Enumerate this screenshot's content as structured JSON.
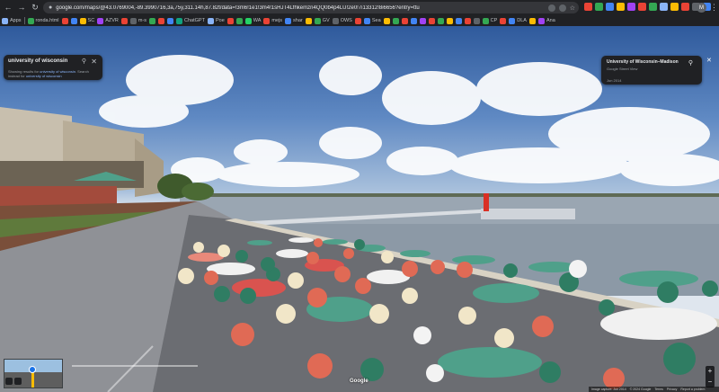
{
  "browser": {
    "url": "google.com/maps/@43.0769004,-89.3990716,3a,75y,311.14h,87.82t/data=!3m6!1e1!3m4!1sHJT4Lfhkemzn4QQ0b4p4LU!2e0!7i13312!8i6656?entry=ttu",
    "profile_initial": "M"
  },
  "bookmarks": [
    {
      "label": "Apps",
      "color": "#8ab4f8"
    },
    {
      "label": "ronda.html",
      "color": "#34a853"
    },
    {
      "label": "",
      "color": "#ea4335"
    },
    {
      "label": "",
      "color": "#4285f4"
    },
    {
      "label": "SC",
      "color": "#fbbc04"
    },
    {
      "label": "AZVR",
      "color": "#a142f4"
    },
    {
      "label": "",
      "color": "#ea4335"
    },
    {
      "label": "m-s",
      "color": "#5f6368"
    },
    {
      "label": "",
      "color": "#34a853"
    },
    {
      "label": "",
      "color": "#ea4335"
    },
    {
      "label": "",
      "color": "#4285f4"
    },
    {
      "label": "ChatGPT",
      "color": "#10a37f"
    },
    {
      "label": "Poe",
      "color": "#8ab4f8"
    },
    {
      "label": "",
      "color": "#ea4335"
    },
    {
      "label": "",
      "color": "#34a853"
    },
    {
      "label": "WA",
      "color": "#25d366"
    },
    {
      "label": "mejs",
      "color": "#ea4335"
    },
    {
      "label": "shar",
      "color": "#4285f4"
    },
    {
      "label": "",
      "color": "#fbbc04"
    },
    {
      "label": "GV",
      "color": "#34a853"
    },
    {
      "label": "OWS",
      "color": "#5f6368"
    },
    {
      "label": "",
      "color": "#ea4335"
    },
    {
      "label": "Sea",
      "color": "#4285f4"
    },
    {
      "label": "",
      "color": "#fbbc04"
    },
    {
      "label": "",
      "color": "#34a853"
    },
    {
      "label": "",
      "color": "#ea4335"
    },
    {
      "label": "",
      "color": "#4285f4"
    },
    {
      "label": "",
      "color": "#a142f4"
    },
    {
      "label": "",
      "color": "#ea4335"
    },
    {
      "label": "",
      "color": "#34a853"
    },
    {
      "label": "",
      "color": "#fbbc04"
    },
    {
      "label": "",
      "color": "#4285f4"
    },
    {
      "label": "",
      "color": "#ea4335"
    },
    {
      "label": "",
      "color": "#5f6368"
    },
    {
      "label": "CP",
      "color": "#34a853"
    },
    {
      "label": "",
      "color": "#ea4335"
    },
    {
      "label": "DLA",
      "color": "#4285f4"
    },
    {
      "label": "",
      "color": "#fbbc04"
    },
    {
      "label": "Ana",
      "color": "#a142f4"
    }
  ],
  "extensions_colors": [
    "#ea4335",
    "#34a853",
    "#4285f4",
    "#fbbc04",
    "#a142f4",
    "#ea4335",
    "#34a853",
    "#8ab4f8",
    "#fbbc04",
    "#ea4335",
    "#5f6368",
    "#4285f4"
  ],
  "search": {
    "query": "university of wisconsin",
    "note_prefix": "Showing results for",
    "note_query": "university of wisconsin",
    "note_mid": ". Search instead for",
    "note_alt": "university of wisconsin"
  },
  "place": {
    "name": "University of Wisconsin–Madison",
    "subtitle": "Google Street View",
    "date": "Jun 2014"
  },
  "map": {
    "logo": "Google",
    "footer": [
      "Image capture: Jun 2014",
      "© 2024 Google",
      "Terms",
      "Privacy",
      "Report a problem"
    ]
  },
  "icons": {
    "back": "arrow-left-icon",
    "forward": "arrow-right-icon",
    "reload": "reload-icon",
    "home": "home-icon",
    "lock": "lock-icon",
    "search": "search-icon",
    "close": "close-icon",
    "pin": "pin-icon",
    "zoom_in": "plus-icon",
    "zoom_out": "minus-icon"
  }
}
